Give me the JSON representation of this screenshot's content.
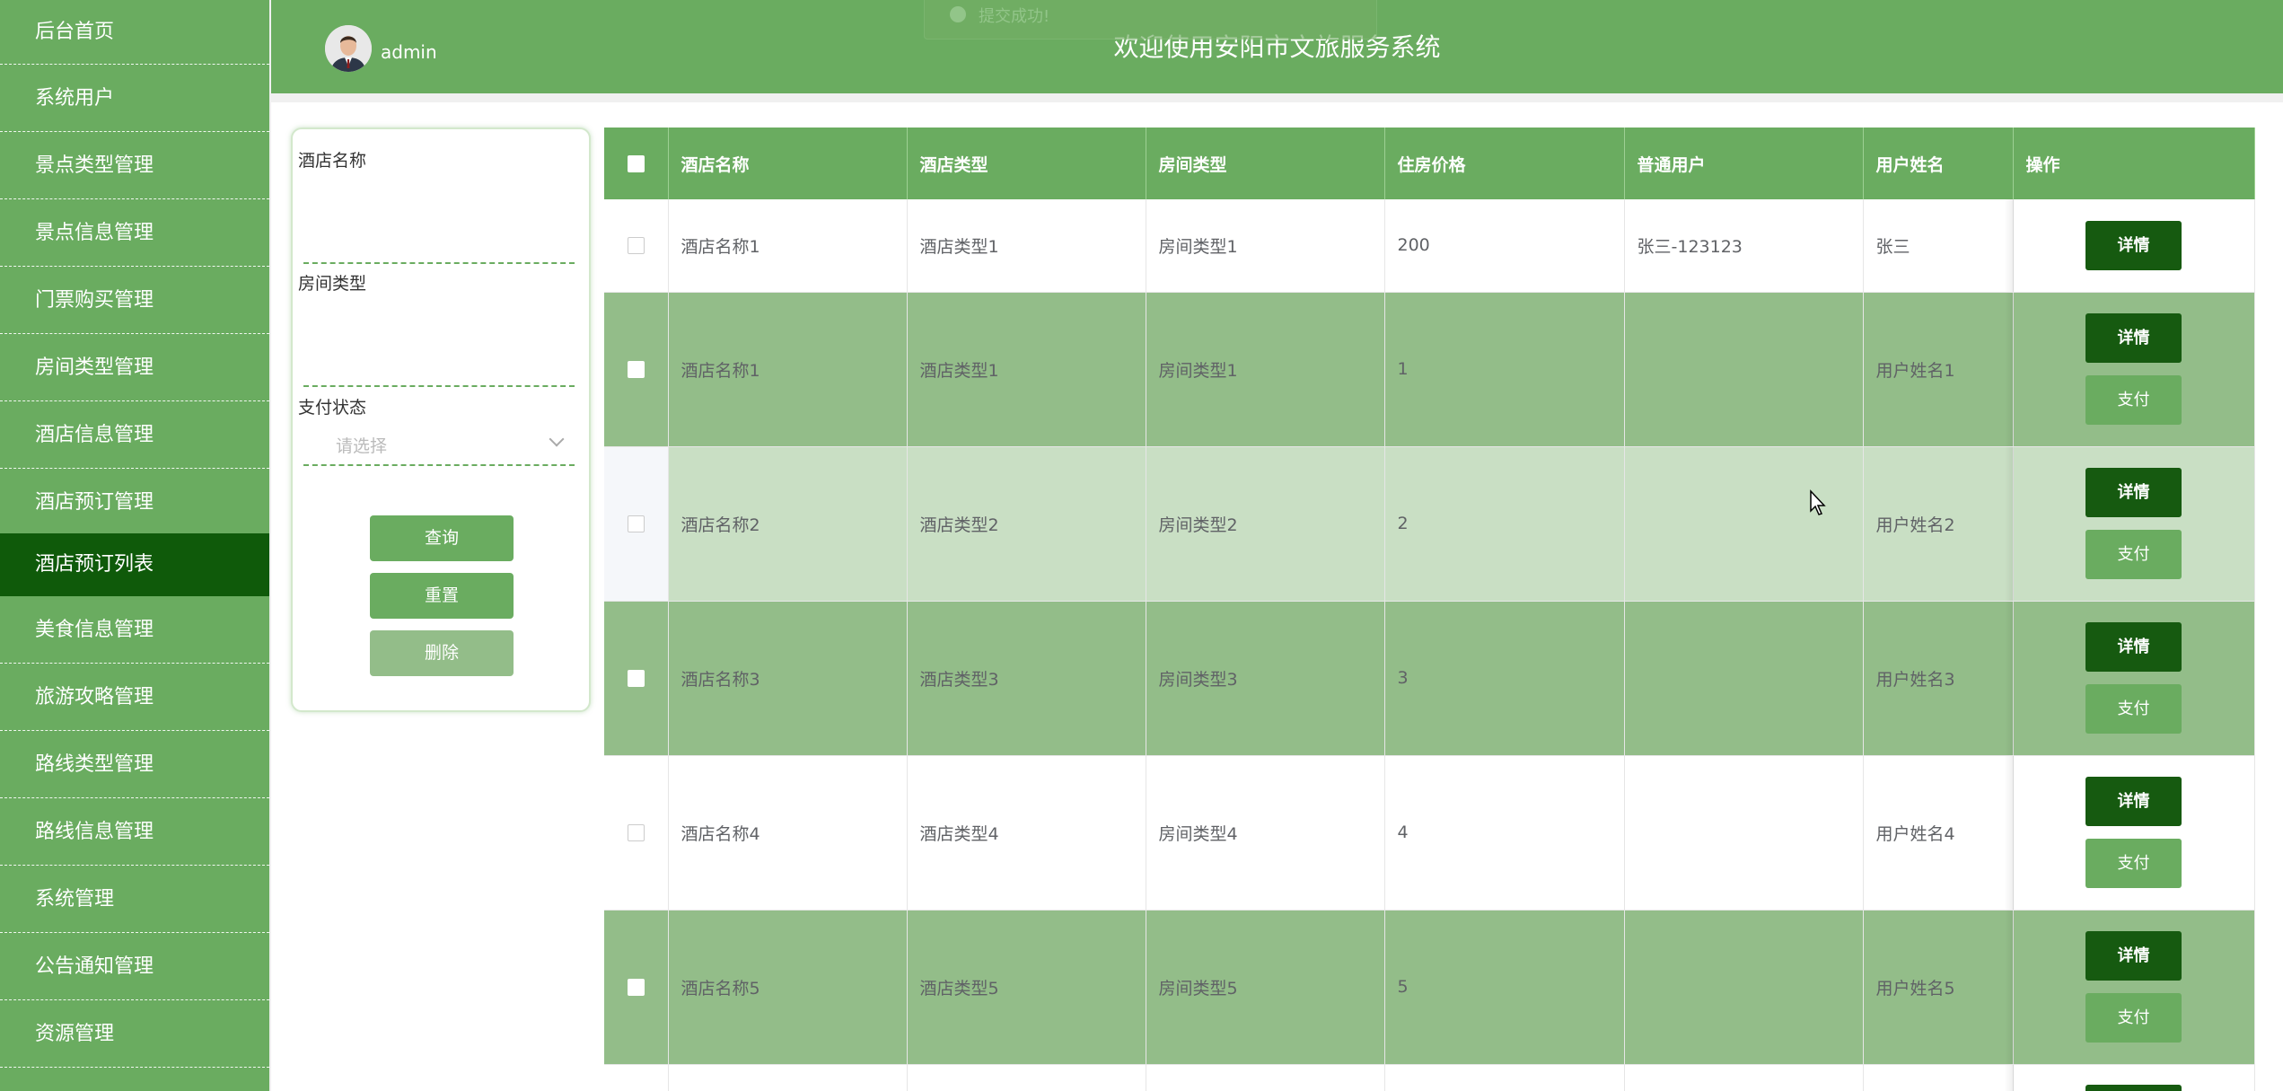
{
  "sidebar": {
    "items": [
      {
        "label": "后台首页"
      },
      {
        "label": "系统用户"
      },
      {
        "label": "景点类型管理"
      },
      {
        "label": "景点信息管理"
      },
      {
        "label": "门票购买管理"
      },
      {
        "label": "房间类型管理"
      },
      {
        "label": "酒店信息管理"
      },
      {
        "label": "酒店预订管理"
      },
      {
        "label": "酒店预订列表"
      },
      {
        "label": "美食信息管理"
      },
      {
        "label": "旅游攻略管理"
      },
      {
        "label": "路线类型管理"
      },
      {
        "label": "路线信息管理"
      },
      {
        "label": "系统管理"
      },
      {
        "label": "公告通知管理"
      },
      {
        "label": "资源管理"
      }
    ],
    "active_label": "酒店预订列表"
  },
  "header": {
    "username": "admin",
    "title": "欢迎使用安阳市文旅服务系统",
    "toast": "提交成功!"
  },
  "filter": {
    "hotel_name_label": "酒店名称",
    "room_type_label": "房间类型",
    "pay_status_label": "支付状态",
    "pay_status_placeholder": "请选择",
    "search_btn": "查询",
    "reset_btn": "重置",
    "delete_btn": "删除"
  },
  "table": {
    "columns": [
      "酒店名称",
      "酒店类型",
      "房间类型",
      "住房价格",
      "普通用户",
      "用户姓名",
      "操作"
    ],
    "detail_label": "详情",
    "pay_label": "支付",
    "rows": [
      {
        "hotel_name": "酒店名称1",
        "hotel_type": "酒店类型1",
        "room_type": "房间类型1",
        "price": "200",
        "user": "张三-123123",
        "user_name": "张三"
      },
      {
        "hotel_name": "酒店名称1",
        "hotel_type": "酒店类型1",
        "room_type": "房间类型1",
        "price": "1",
        "user": "",
        "user_name": "用户姓名1"
      },
      {
        "hotel_name": "酒店名称2",
        "hotel_type": "酒店类型2",
        "room_type": "房间类型2",
        "price": "2",
        "user": "",
        "user_name": "用户姓名2"
      },
      {
        "hotel_name": "酒店名称3",
        "hotel_type": "酒店类型3",
        "room_type": "房间类型3",
        "price": "3",
        "user": "",
        "user_name": "用户姓名3"
      },
      {
        "hotel_name": "酒店名称4",
        "hotel_type": "酒店类型4",
        "room_type": "房间类型4",
        "price": "4",
        "user": "",
        "user_name": "用户姓名4"
      },
      {
        "hotel_name": "酒店名称5",
        "hotel_type": "酒店类型5",
        "room_type": "房间类型5",
        "price": "5",
        "user": "",
        "user_name": "用户姓名5"
      }
    ]
  },
  "colors": {
    "primary": "#6aac60",
    "active_nav": "#0f5a0a",
    "detail_button": "#165a10",
    "row_dark": "#93bd89",
    "row_light": "#c9dfc4"
  }
}
